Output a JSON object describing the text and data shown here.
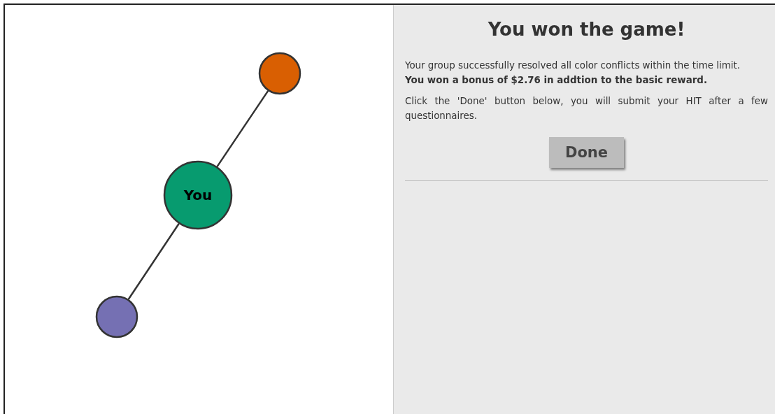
{
  "graph": {
    "nodes": [
      {
        "kind": "peer",
        "color": "#d95f02"
      },
      {
        "kind": "self",
        "label": "You",
        "color": "#079b6f"
      },
      {
        "kind": "peer",
        "color": "#7570b3"
      }
    ]
  },
  "result": {
    "title": "You won the game!",
    "paragraphs": [
      {
        "text": "Your group successfully resolved all color conflicts within the time limit.",
        "bold": false
      },
      {
        "text": "You won a bonus of $2.76 in addtion to the basic reward.",
        "bold": true
      },
      {
        "text": "Click the 'Done' button below, you will submit your HIT after a few questionnaires.",
        "bold": false
      }
    ],
    "button": "Done"
  }
}
